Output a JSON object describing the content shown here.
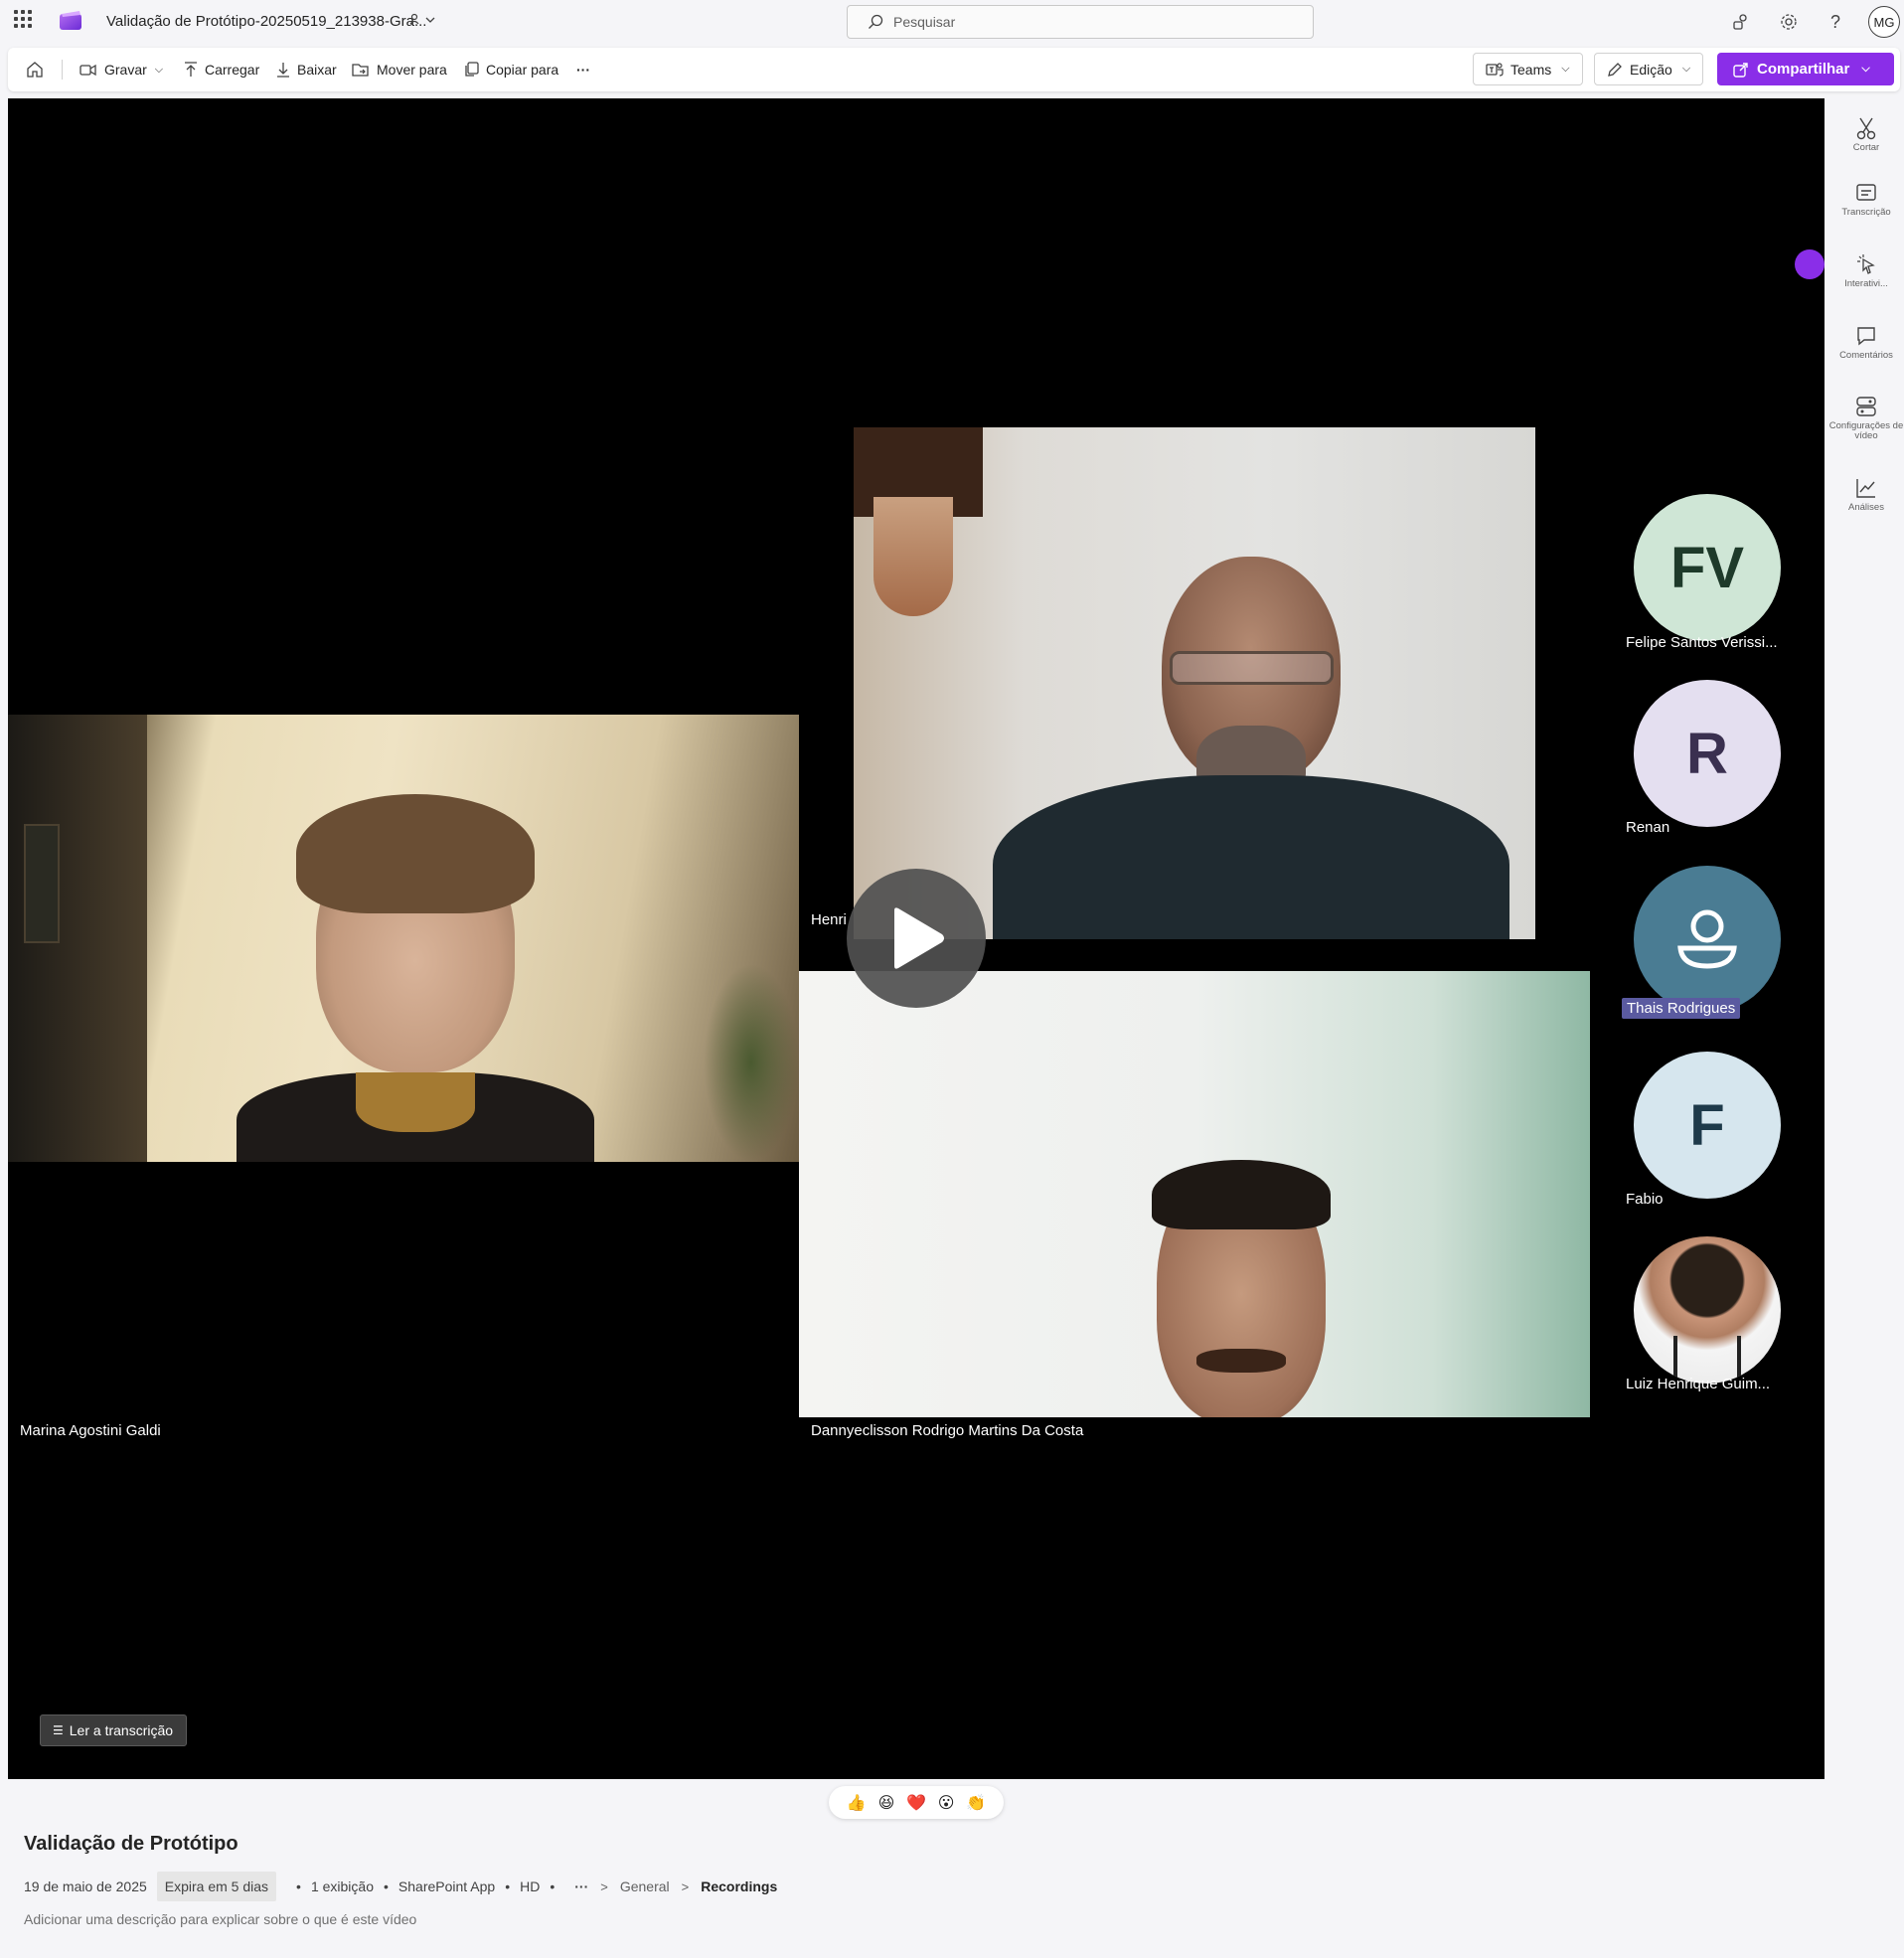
{
  "header": {
    "doc_title": "Validação de Protótipo-20250519_213938-Gra...",
    "search_placeholder": "Pesquisar",
    "avatar_initials": "MG"
  },
  "toolbar": {
    "record": "Gravar",
    "upload": "Carregar",
    "download": "Baixar",
    "move": "Mover para",
    "copy": "Copiar para",
    "more": "···",
    "teams": "Teams",
    "edit": "Edição",
    "share": "Compartilhar"
  },
  "stage": {
    "tiles": {
      "marina": "Marina Agostini Galdi",
      "henri": "Henri",
      "danny": "Dannyeclisson Rodrigo Martins Da Costa"
    },
    "participants": [
      {
        "initials": "FV",
        "name": "Felipe Santos Verissi..."
      },
      {
        "initials": "R",
        "name": "Renan"
      },
      {
        "initials": "",
        "name": "Thais Rodrigues"
      },
      {
        "initials": "F",
        "name": "Fabio"
      },
      {
        "initials": "",
        "name": "Luiz Henrique Guim..."
      }
    ],
    "transcript_button": "Ler a transcrição"
  },
  "rail": {
    "items": [
      {
        "label": "Cortar",
        "icon": "scissors-icon"
      },
      {
        "label": "Transcrição",
        "icon": "transcript-icon"
      },
      {
        "label": "Interativi...",
        "icon": "cursor-icon"
      },
      {
        "label": "Comentários",
        "icon": "comment-icon"
      },
      {
        "label": "Configurações de vídeo",
        "icon": "video-settings-icon"
      },
      {
        "label": "Análises",
        "icon": "analytics-icon"
      }
    ]
  },
  "reactions": [
    "👍",
    "😆",
    "❤️",
    "😮",
    "👏"
  ],
  "info": {
    "title": "Validação de Protótipo",
    "date": "19 de maio de 2025",
    "expires": "Expira em 5 dias",
    "views": "1 exibição",
    "app": "SharePoint App",
    "quality": "HD",
    "more": "···",
    "crumb1": "General",
    "crumb2": "Recordings",
    "description_placeholder": "Adicionar uma descrição para explicar sobre o que é este vídeo"
  },
  "colors": {
    "accent": "#8a2ee8",
    "felipe_bg": "#cfe6d6",
    "renan_bg": "#e4dff0",
    "thais_bg": "#4a7c93",
    "fabio_bg": "#d6e6ee"
  }
}
